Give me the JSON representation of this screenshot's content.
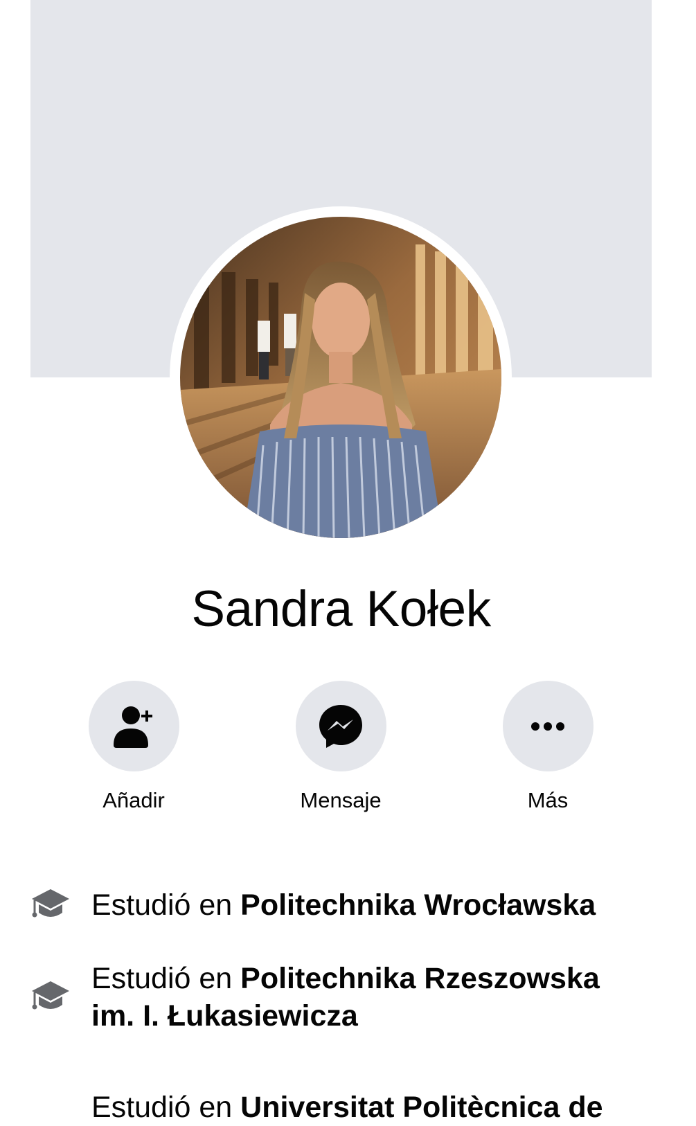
{
  "profile": {
    "name": "Sandra Kołek"
  },
  "actions": [
    {
      "label": "Añadir",
      "icon": "add-friend-icon"
    },
    {
      "label": "Mensaje",
      "icon": "messenger-icon"
    },
    {
      "label": "Más",
      "icon": "more-icon"
    }
  ],
  "education": [
    {
      "prefix": "Estudió en ",
      "school": "Politechnika Wrocławska"
    },
    {
      "prefix": "Estudió en ",
      "school": "Politechnika Rzeszowska im. I. Łukasiewicza"
    },
    {
      "prefix": "Estudió en ",
      "school": "Universitat Politècnica de"
    }
  ],
  "colors": {
    "button_bg": "#e4e6eb",
    "cover_bg": "#e4e6eb",
    "text": "#050505",
    "icon_gray": "#65676b"
  }
}
